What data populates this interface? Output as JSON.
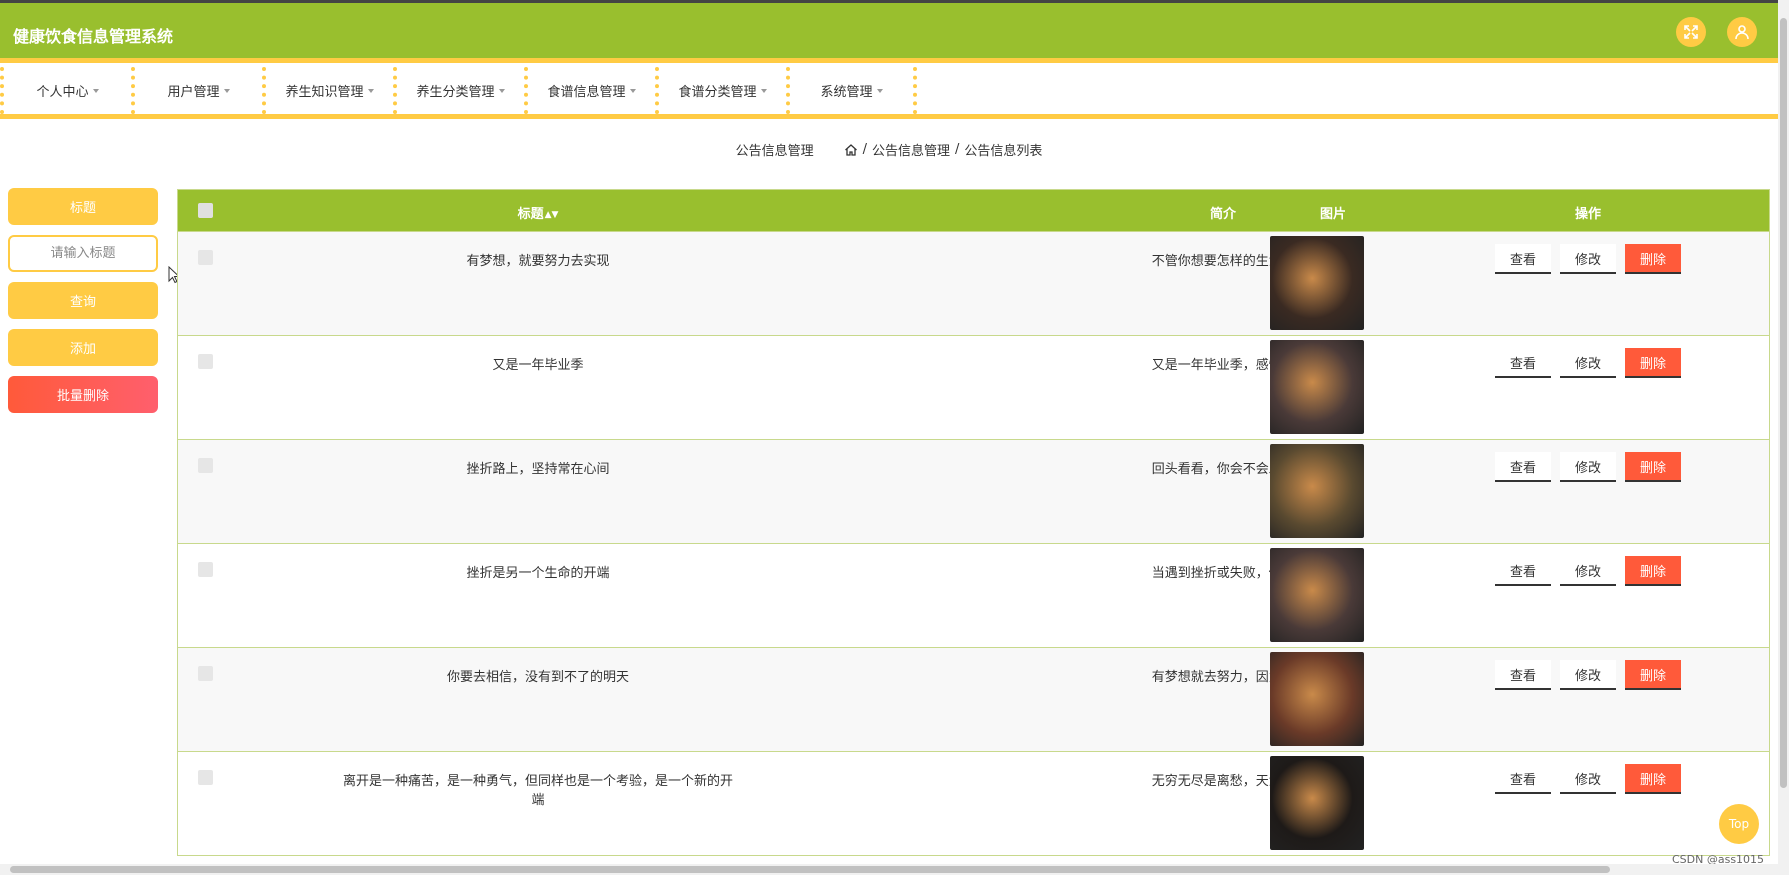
{
  "header": {
    "title": "健康饮食信息管理系统",
    "fullscreen_icon": "fullscreen-icon",
    "user_icon": "user-icon"
  },
  "nav": [
    {
      "label": "个人中心"
    },
    {
      "label": "用户管理"
    },
    {
      "label": "养生知识管理"
    },
    {
      "label": "养生分类管理"
    },
    {
      "label": "食谱信息管理"
    },
    {
      "label": "食谱分类管理"
    },
    {
      "label": "系统管理"
    }
  ],
  "breadcrumb": {
    "title": "公告信息管理",
    "sep": "/",
    "path1": "公告信息管理",
    "path2": "公告信息列表"
  },
  "sidebar": {
    "label_title": "标题",
    "search_placeholder": "请输入标题",
    "query": "查询",
    "add": "添加",
    "batch_delete": "批量删除"
  },
  "table": {
    "columns": {
      "title": "标题",
      "intro": "简介",
      "image": "图片",
      "ops": "操作"
    },
    "ops": {
      "view": "查看",
      "edit": "修改",
      "delete": "删除"
    },
    "rows": [
      {
        "title": "有梦想，就要努力去实现",
        "intro": "不管你想要怎样的生活...",
        "img": "#3a2a22"
      },
      {
        "title": "又是一年毕业季",
        "intro": "又是一年毕业季，感慨...",
        "img": "#4a3a38"
      },
      {
        "title": "挫折路上，坚持常在心间",
        "intro": "回头看看，你会不会发...",
        "img": "#5a4a30"
      },
      {
        "title": "挫折是另一个生命的开端",
        "intro": "当遇到挫折或失败，你...",
        "img": "#4a3a38"
      },
      {
        "title": "你要去相信，没有到不了的明天",
        "intro": "有梦想就去努力，因为...",
        "img": "#6a3a28"
      },
      {
        "title": "离开是一种痛苦，是一种勇气，但同样也是一个考验，是一个新的开端",
        "intro": "无穷无尽是离愁，天涯...",
        "img": "#1e1a18"
      }
    ]
  },
  "top_button": "Top",
  "watermark": "CSDN @ass1015"
}
